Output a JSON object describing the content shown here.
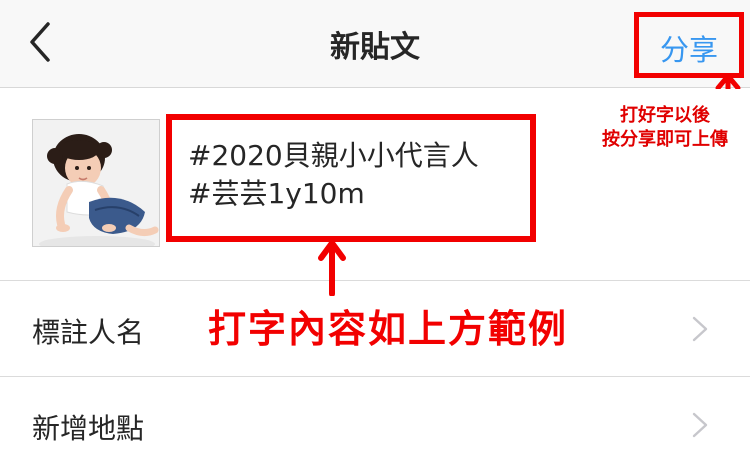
{
  "nav": {
    "title": "新貼文",
    "share_label": "分享",
    "back_icon": "chevron-left-icon"
  },
  "post": {
    "caption_lines": [
      "#2020貝親小小代言人",
      "#芸芸1y10m"
    ],
    "thumbnail": "toddler-photo"
  },
  "annotations": {
    "side_note_lines": [
      "打好字以後",
      "按分享即可上傳"
    ],
    "main_note": "打字內容如上方範例",
    "highlight_color": "#f20000"
  },
  "menu": {
    "items": [
      {
        "label": "標註人名",
        "icon": "chevron-right-icon"
      },
      {
        "label": "新增地點",
        "icon": "chevron-right-icon"
      }
    ]
  },
  "colors": {
    "accent": "#3897f0",
    "annotation_red": "#f20000"
  }
}
